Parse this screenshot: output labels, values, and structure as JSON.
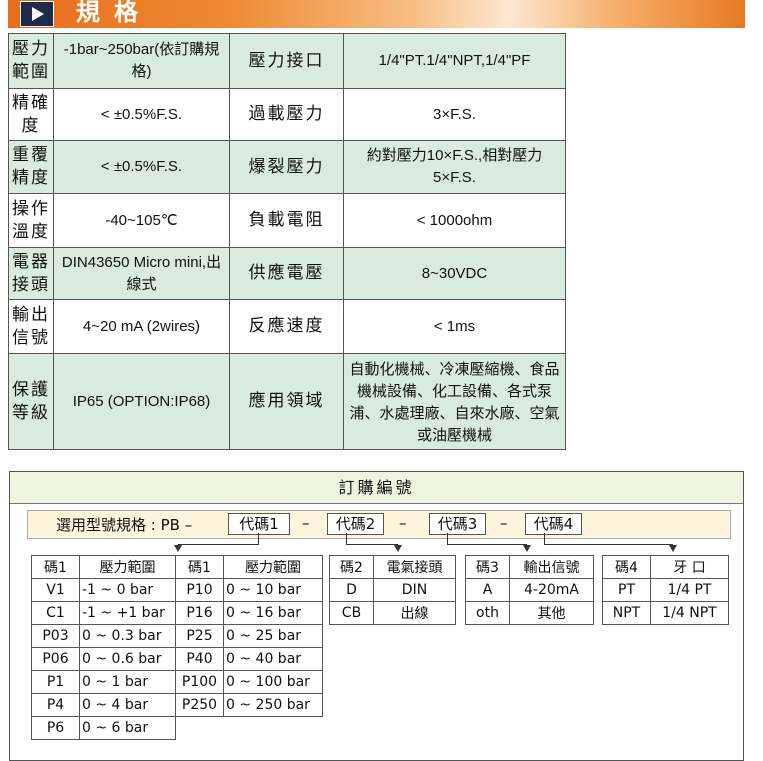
{
  "header": {
    "title": "規格"
  },
  "spec_rows": [
    {
      "l1": "壓力範圍",
      "v1": "-1bar~250bar(依訂購規格)",
      "l2": "壓力接口",
      "v2": "1/4\"PT.1/4\"NPT,1/4\"PF"
    },
    {
      "l1": "精確度",
      "v1": "< ±0.5%F.S.",
      "l2": "過載壓力",
      "v2": "3×F.S."
    },
    {
      "l1": "重覆精度",
      "v1": "< ±0.5%F.S.",
      "l2": "爆裂壓力",
      "v2": "約對壓力10×F.S.,相對壓力5×F.S."
    },
    {
      "l1": "操作溫度",
      "v1": "-40~105℃",
      "l2": "負載電阻",
      "v2": "< 1000ohm"
    },
    {
      "l1": "電器接頭",
      "v1": "DIN43650 Micro mini,出線式",
      "l2": "供應電壓",
      "v2": "8~30VDC"
    },
    {
      "l1": "輸出信號",
      "v1": "4~20 mA (2wires)",
      "l2": "反應速度",
      "v2": "< 1ms"
    },
    {
      "l1": "保護等級",
      "v1": "IP65 (OPTION:IP68)",
      "l2": "應用領域",
      "v2": "自動化機械、冷凍壓縮機、食品機械設備、化工設備、各式泵浦、水處理廠、自來水廠、空氣或油壓機械"
    }
  ],
  "order": {
    "title": "訂購編號",
    "model_label": "選用型號規格 : PB –",
    "dash": "–",
    "codes": [
      "代碼1",
      "代碼2",
      "代碼3",
      "代碼4"
    ],
    "pressure": {
      "headers": [
        "碼1",
        "壓力範圍",
        "碼1",
        "壓力範圍"
      ],
      "rows": [
        [
          "V1",
          "-1 ~ 0 bar",
          "P10",
          "0 ~ 10 bar"
        ],
        [
          "C1",
          "-1 ~ +1 bar",
          "P16",
          "0 ~ 16 bar"
        ],
        [
          "P03",
          "0 ~ 0.3 bar",
          "P25",
          "0 ~ 25 bar"
        ],
        [
          "P06",
          "0 ~ 0.6 bar",
          "P40",
          "0 ~ 40 bar"
        ],
        [
          "P1",
          "0 ~ 1 bar",
          "P100",
          "0 ~ 100 bar"
        ],
        [
          "P4",
          "0 ~ 4 bar",
          "P250",
          "0 ~ 250 bar"
        ],
        [
          "P6",
          "0 ~ 6 bar",
          "",
          ""
        ]
      ]
    },
    "connector": {
      "headers": [
        "碼2",
        "電氣接頭"
      ],
      "rows": [
        [
          "D",
          "DIN"
        ],
        [
          "CB",
          "出線"
        ]
      ]
    },
    "output": {
      "headers": [
        "碼3",
        "輸出信號"
      ],
      "rows": [
        [
          "A",
          "4-20mA"
        ],
        [
          "oth",
          "其他"
        ]
      ]
    },
    "thread": {
      "headers": [
        "碼4",
        "牙 口"
      ],
      "rows": [
        [
          "PT",
          "1/4 PT"
        ],
        [
          "NPT",
          "1/4 NPT"
        ]
      ]
    }
  }
}
